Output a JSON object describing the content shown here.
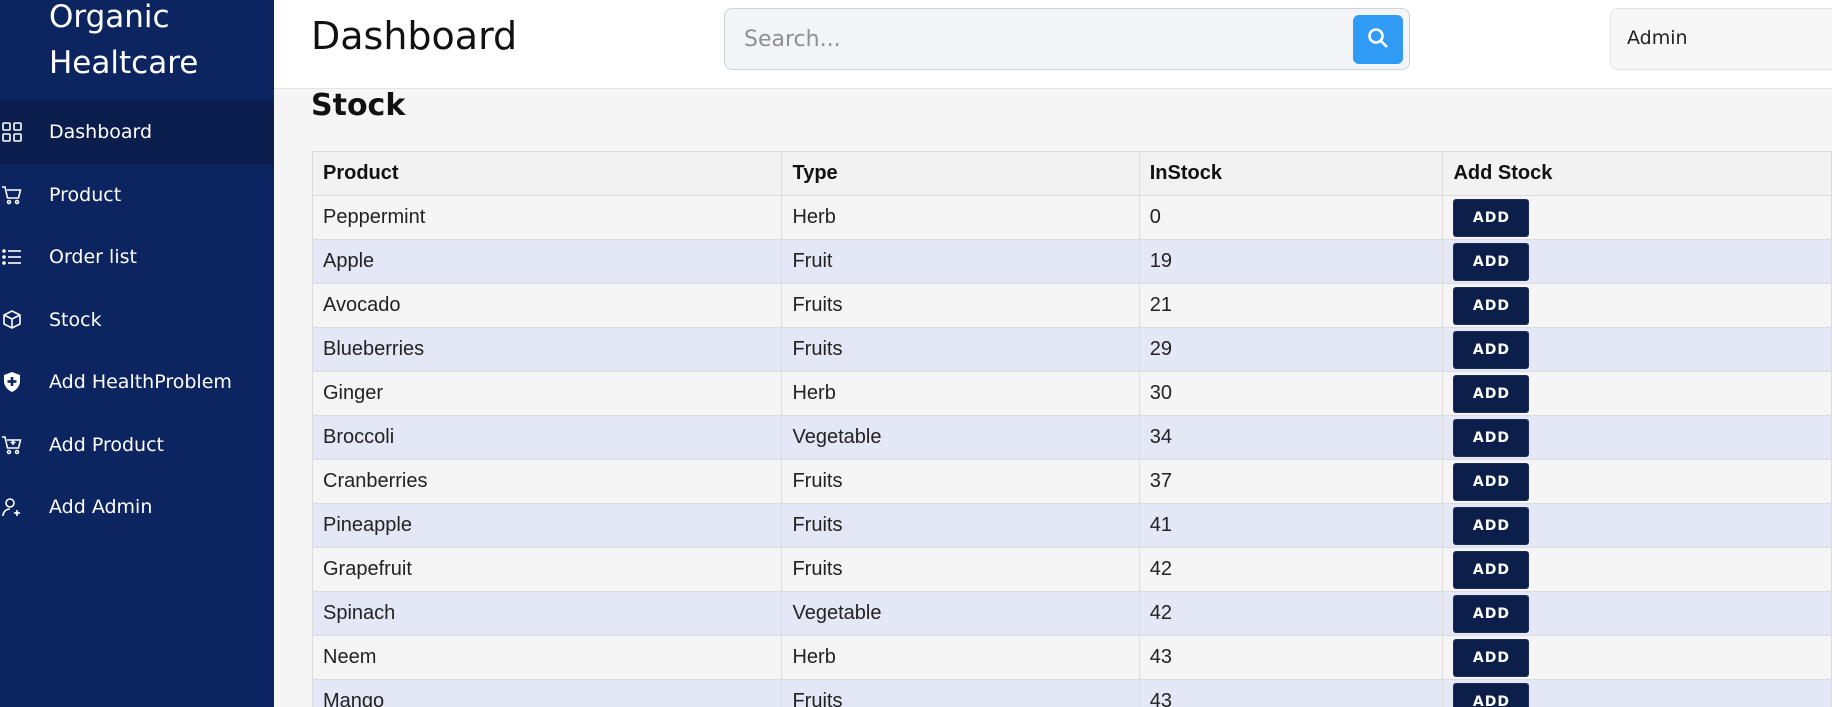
{
  "brand": {
    "line1": "Organic",
    "line2": "Healtcare"
  },
  "sidebar": {
    "items": [
      {
        "label": "Dashboard",
        "icon": "grid-icon"
      },
      {
        "label": "Product",
        "icon": "cart-icon"
      },
      {
        "label": "Order list",
        "icon": "list-icon"
      },
      {
        "label": "Stock",
        "icon": "box-icon"
      },
      {
        "label": "Add HealthProblem",
        "icon": "shield-plus-icon"
      },
      {
        "label": "Add Product",
        "icon": "cart-plus-icon"
      },
      {
        "label": "Add Admin",
        "icon": "user-plus-icon"
      }
    ],
    "active_index": 0
  },
  "header": {
    "title": "Dashboard",
    "search_placeholder": "Search...",
    "user": "Admin"
  },
  "section": {
    "title": "Stock"
  },
  "table": {
    "headers": [
      "Product",
      "Type",
      "InStock",
      "Add Stock"
    ],
    "button_label": "ADD",
    "rows": [
      {
        "product": "Peppermint",
        "type": "Herb",
        "instock": "0"
      },
      {
        "product": "Apple",
        "type": "Fruit",
        "instock": "19"
      },
      {
        "product": "Avocado",
        "type": "Fruits",
        "instock": "21"
      },
      {
        "product": "Blueberries",
        "type": "Fruits",
        "instock": "29"
      },
      {
        "product": "Ginger",
        "type": "Herb",
        "instock": "30"
      },
      {
        "product": "Broccoli",
        "type": "Vegetable",
        "instock": "34"
      },
      {
        "product": "Cranberries",
        "type": "Fruits",
        "instock": "37"
      },
      {
        "product": "Pineapple",
        "type": "Fruits",
        "instock": "41"
      },
      {
        "product": "Grapefruit",
        "type": "Fruits",
        "instock": "42"
      },
      {
        "product": "Spinach",
        "type": "Vegetable",
        "instock": "42"
      },
      {
        "product": "Neem",
        "type": "Herb",
        "instock": "43"
      },
      {
        "product": "Mango",
        "type": "Fruits",
        "instock": "43"
      }
    ]
  },
  "colors": {
    "sidebar": "#0c2560",
    "sidebar_active": "#0a1d4c",
    "accent": "#2f9bf5",
    "button": "#0c1f4a",
    "row_alt": "#e4e7f5"
  }
}
